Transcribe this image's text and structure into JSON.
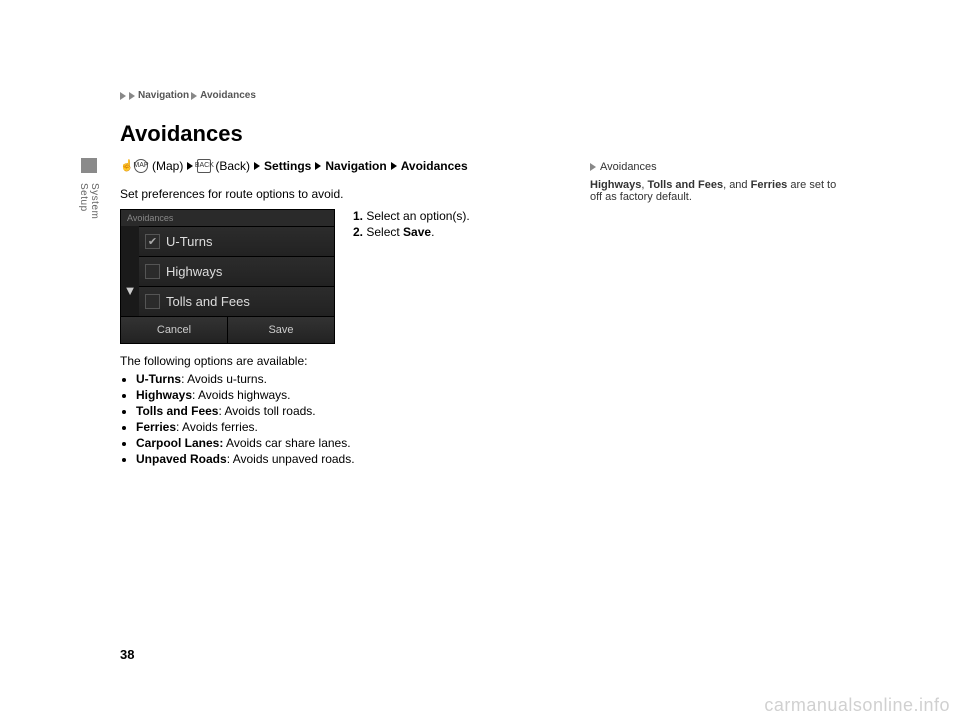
{
  "breadcrumb_top": {
    "a": "Navigation",
    "b": "Avoidances"
  },
  "title": "Avoidances",
  "path": {
    "map_btn": "MAP",
    "map_label": "(Map)",
    "back_btn": "BACK",
    "back_label": "(Back)",
    "s1": "Settings",
    "s2": "Navigation",
    "s3": "Avoidances"
  },
  "intro": "Set preferences for route options to avoid.",
  "screen": {
    "header": "Avoidances",
    "items": [
      {
        "label": "U-Turns",
        "checked": true
      },
      {
        "label": "Highways",
        "checked": false
      },
      {
        "label": "Tolls and Fees",
        "checked": false
      }
    ],
    "cancel": "Cancel",
    "save": "Save"
  },
  "steps": {
    "n1": "1.",
    "t1a": "Select an option(s).",
    "n2": "2.",
    "t2a": "Select ",
    "t2b": "Save",
    "t2c": "."
  },
  "below_intro": "The following options are available:",
  "options": [
    {
      "term": "U-Turns",
      "desc": ": Avoids u-turns."
    },
    {
      "term": "Highways",
      "desc": ": Avoids highways."
    },
    {
      "term": "Tolls and Fees",
      "desc": ": Avoids toll roads."
    },
    {
      "term": "Ferries",
      "desc": ": Avoids ferries."
    },
    {
      "term": "Carpool Lanes:",
      "desc": " Avoids car share lanes."
    },
    {
      "term": "Unpaved Roads",
      "desc": ": Avoids unpaved roads."
    }
  ],
  "sidebar": {
    "head": "Avoidances",
    "note_a": "Highways",
    "note_b": ", ",
    "note_c": "Tolls and Fees",
    "note_d": ", and ",
    "note_e": "Ferries",
    "note_f": " are set to off as factory default."
  },
  "side_tab": "System Setup",
  "page_number": "38",
  "watermark": "carmanualsonline.info"
}
